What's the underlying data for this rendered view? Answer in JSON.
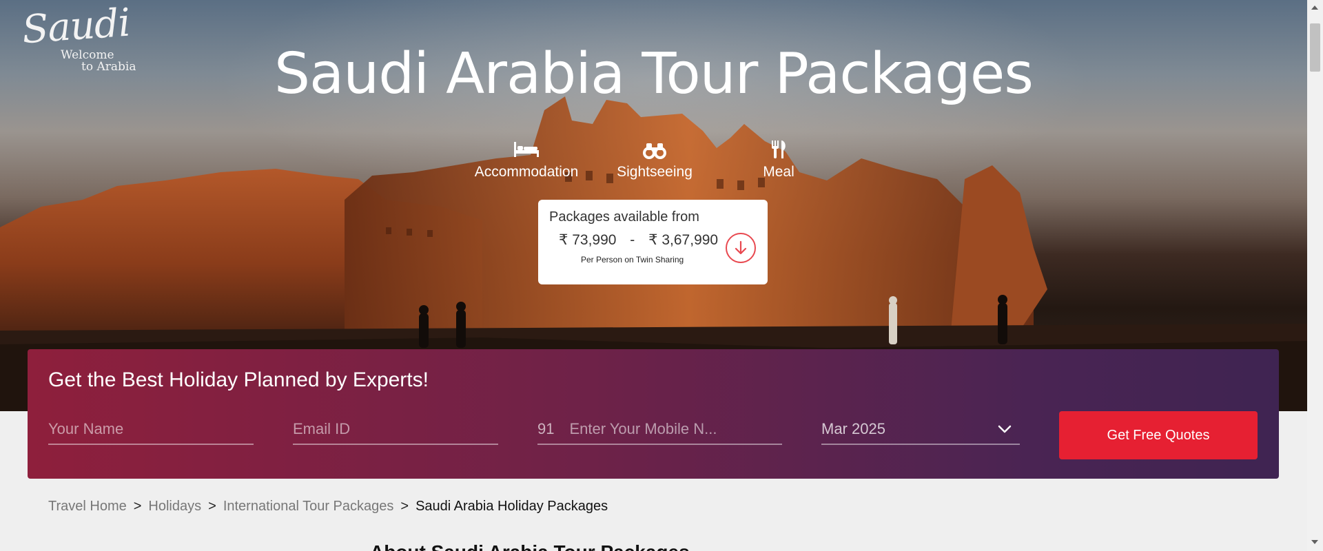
{
  "logo": {
    "script": "Saudi",
    "tagline_line1": "Welcome",
    "tagline_line2": "to Arabia"
  },
  "hero": {
    "title": "Saudi Arabia Tour Packages",
    "features": [
      {
        "label": "Accommodation",
        "icon": "bed-icon"
      },
      {
        "label": "Sightseeing",
        "icon": "binoculars-icon"
      },
      {
        "label": "Meal",
        "icon": "fork-knife-icon"
      }
    ]
  },
  "price_card": {
    "title": "Packages available from",
    "currency": "₹",
    "min_price": "73,990",
    "separator": "-",
    "max_price": "3,67,990",
    "note": "Per Person on Twin Sharing",
    "down_icon": "arrow-down-circle-icon"
  },
  "form": {
    "heading": "Get the Best Holiday Planned by Experts!",
    "name_placeholder": "Your Name",
    "email_placeholder": "Email ID",
    "country_code": "91",
    "mobile_placeholder": "Enter Your Mobile N...",
    "month_value": "Mar 2025",
    "submit_label": "Get Free Quotes"
  },
  "breadcrumb": {
    "items": [
      "Travel Home",
      "Holidays",
      "International Tour Packages"
    ],
    "current": "Saudi Arabia Holiday Packages",
    "separator": ">"
  },
  "section": {
    "heading": "About Saudi Arabia Tour Packages"
  },
  "colors": {
    "accent_red": "#e62032",
    "form_gradient_start": "#8e1f3c",
    "form_gradient_end": "#3f2452"
  }
}
